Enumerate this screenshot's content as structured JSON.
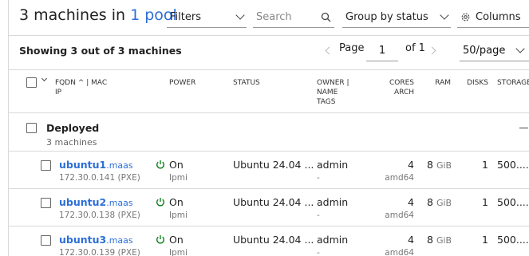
{
  "header": {
    "title_prefix": "3 machines in",
    "title_link": "1 pool",
    "filters_label": "Filters",
    "search_placeholder": "Search",
    "group_by_label": "Group by status",
    "columns_label": "Columns"
  },
  "pagination": {
    "showing": "Showing 3 out of 3 machines",
    "page_label": "Page",
    "page_value": "1",
    "of_label": "of 1",
    "per_page": "50/page"
  },
  "columns": {
    "fqdn": "FQDN",
    "sort": "^",
    "mac": "| MAC",
    "ip": "IP",
    "power": "POWER",
    "status": "STATUS",
    "owner": "OWNER |",
    "name": "NAME",
    "tags": "TAGS",
    "cores": "CORES",
    "arch": "ARCH",
    "ram": "RAM",
    "disks": "DISKS",
    "storage": "STORAGE"
  },
  "group": {
    "title": "Deployed",
    "count": "3 machines",
    "collapse_symbol": "—"
  },
  "machines": [
    {
      "hostname": "ubuntu1",
      "domain": ".maas",
      "ip": "172.30.0.141 (PXE)",
      "power": "On",
      "power_type": "Ipmi",
      "status": "Ubuntu 24.04 ...",
      "owner": "admin",
      "tags": "-",
      "cores": "4",
      "arch": "amd64",
      "ram": "8",
      "ram_unit": "GiB",
      "disks": "1",
      "storage": "500...."
    },
    {
      "hostname": "ubuntu2",
      "domain": ".maas",
      "ip": "172.30.0.138 (PXE)",
      "power": "On",
      "power_type": "Ipmi",
      "status": "Ubuntu 24.04 ...",
      "owner": "admin",
      "tags": "-",
      "cores": "4",
      "arch": "amd64",
      "ram": "8",
      "ram_unit": "GiB",
      "disks": "1",
      "storage": "500...."
    },
    {
      "hostname": "ubuntu3",
      "domain": ".maas",
      "ip": "172.30.0.139 (PXE)",
      "power": "On",
      "power_type": "Ipmi",
      "status": "Ubuntu 24.04 ...",
      "owner": "admin",
      "tags": "-",
      "cores": "4",
      "arch": "amd64",
      "ram": "8",
      "ram_unit": "GiB",
      "disks": "1",
      "storage": "500...."
    }
  ],
  "colors": {
    "link": "#2d6fd8",
    "power_on": "#0e8420"
  }
}
